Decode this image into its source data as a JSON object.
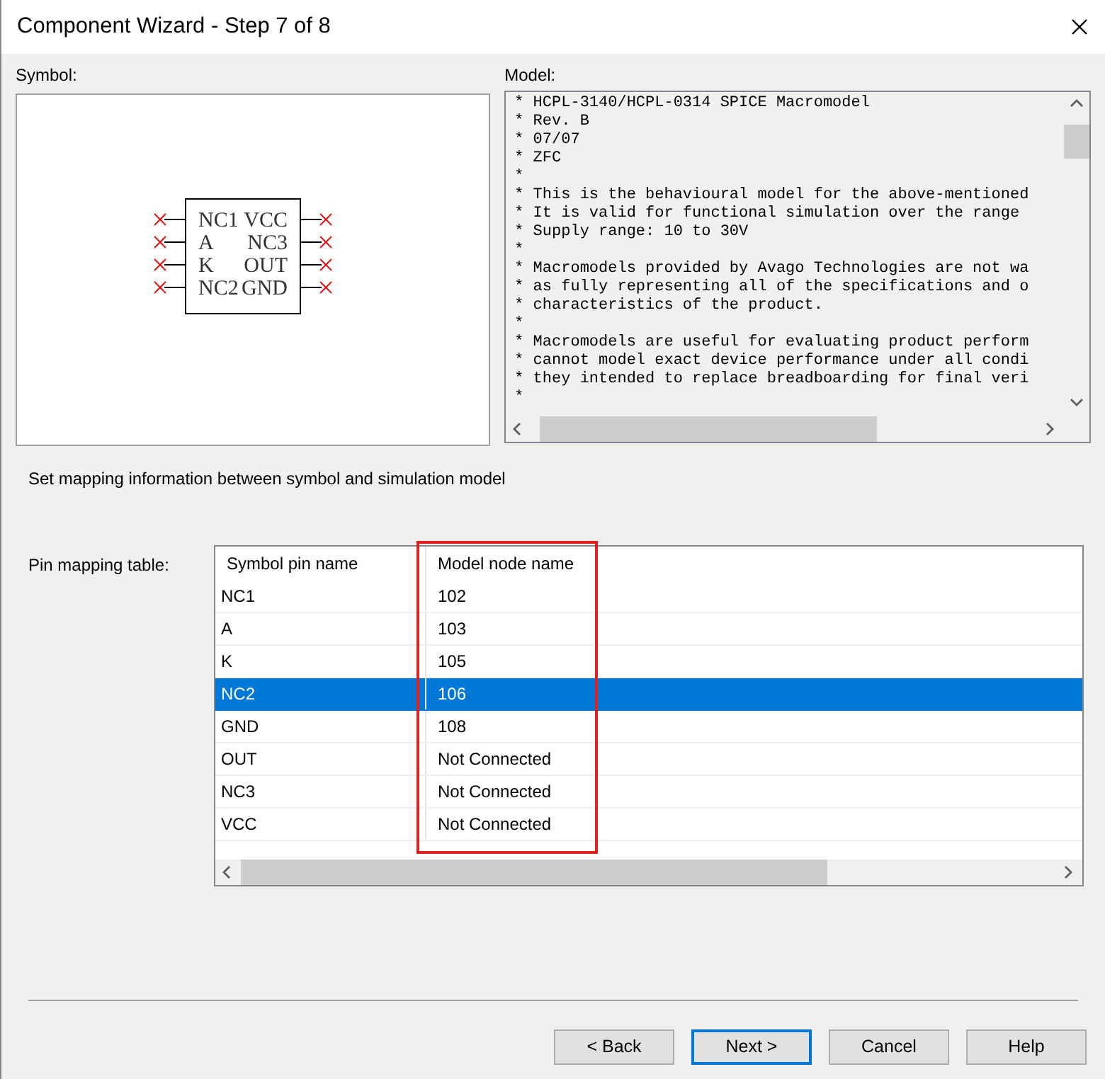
{
  "window": {
    "title": "Component Wizard - Step 7 of 8"
  },
  "symbol": {
    "label": "Symbol:",
    "left_pins": [
      "NC1",
      "A",
      "K",
      "NC2"
    ],
    "right_pins": [
      "VCC",
      "NC3",
      "OUT",
      "GND"
    ]
  },
  "model": {
    "label": "Model:",
    "lines": [
      "* HCPL-3140/HCPL-0314 SPICE Macromodel",
      "* Rev. B",
      "* 07/07",
      "* ZFC",
      "*",
      "* This is the behavioural model for the above-mentioned",
      "* It is valid for functional simulation over the range",
      "* Supply range: 10 to 30V",
      "*",
      "* Macromodels provided by Avago Technologies are not wa",
      "* as fully representing all of the specifications and o",
      "* characteristics of the product.",
      "*",
      "* Macromodels are useful for evaluating product perform",
      "* cannot model exact device performance under all condi",
      "* they intended to replace breadboarding for final veri",
      "*"
    ]
  },
  "instruction": "Set mapping information between symbol and simulation model",
  "pin_table": {
    "label": "Pin mapping table:",
    "columns": [
      {
        "label": "Symbol pin name",
        "highlighted": false
      },
      {
        "label": "Model node name",
        "highlighted": true
      }
    ],
    "rows": [
      {
        "pin": "NC1",
        "node": "102",
        "selected": false
      },
      {
        "pin": "A",
        "node": "103",
        "selected": false
      },
      {
        "pin": "K",
        "node": "105",
        "selected": false
      },
      {
        "pin": "NC2",
        "node": "106",
        "selected": true
      },
      {
        "pin": "GND",
        "node": "108",
        "selected": false
      },
      {
        "pin": "OUT",
        "node": "Not Connected",
        "selected": false
      },
      {
        "pin": "NC3",
        "node": "Not Connected",
        "selected": false
      },
      {
        "pin": "VCC",
        "node": "Not Connected",
        "selected": false
      }
    ]
  },
  "buttons": [
    {
      "label": "< Back",
      "default": false
    },
    {
      "label": "Next >",
      "default": true
    },
    {
      "label": "Cancel",
      "default": false
    },
    {
      "label": "Help",
      "default": false
    }
  ]
}
